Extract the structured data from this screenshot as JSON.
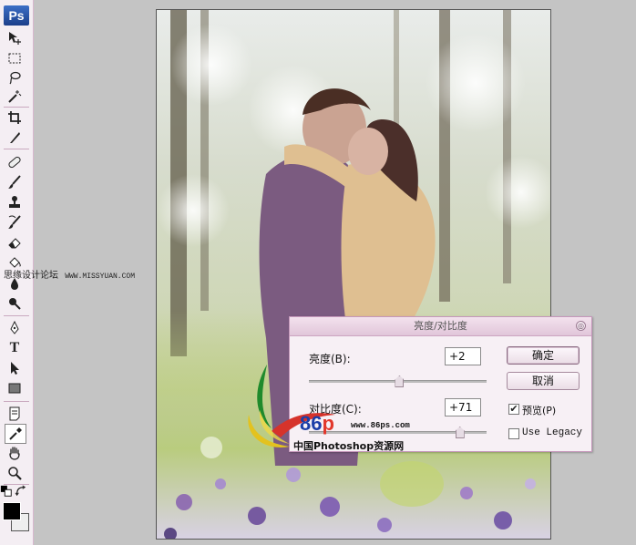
{
  "app": {
    "logo_text": "Ps"
  },
  "toolbox": {
    "tools": [
      {
        "name": "move-tool",
        "icon": "move-icon"
      },
      {
        "name": "marquee-tool",
        "icon": "marquee-icon"
      },
      {
        "name": "lasso-tool",
        "icon": "lasso-icon"
      },
      {
        "name": "magic-wand-tool",
        "icon": "magic-wand-icon"
      },
      {
        "name": "crop-tool",
        "icon": "crop-icon"
      },
      {
        "name": "slice-tool",
        "icon": "slice-icon"
      },
      {
        "name": "healing-brush-tool",
        "icon": "bandage-icon"
      },
      {
        "name": "brush-tool",
        "icon": "brush-icon"
      },
      {
        "name": "clone-stamp-tool",
        "icon": "stamp-icon"
      },
      {
        "name": "history-brush-tool",
        "icon": "history-brush-icon"
      },
      {
        "name": "eraser-tool",
        "icon": "eraser-icon"
      },
      {
        "name": "paint-bucket-tool",
        "icon": "bucket-icon"
      },
      {
        "name": "blur-tool",
        "icon": "drop-icon"
      },
      {
        "name": "dodge-tool",
        "icon": "dodge-icon"
      },
      {
        "name": "pen-tool",
        "icon": "pen-icon"
      },
      {
        "name": "type-tool",
        "icon": "type-icon",
        "glyph": "T"
      },
      {
        "name": "path-selection-tool",
        "icon": "arrow-icon"
      },
      {
        "name": "shape-tool",
        "icon": "rectangle-icon"
      },
      {
        "name": "notes-tool",
        "icon": "note-icon"
      },
      {
        "name": "eyedropper-tool",
        "icon": "eyedropper-icon"
      },
      {
        "name": "hand-tool",
        "icon": "hand-icon"
      },
      {
        "name": "zoom-tool",
        "icon": "zoom-icon"
      }
    ],
    "foreground_color": "#000000",
    "background_color": "#eeeeee"
  },
  "watermark_top": {
    "text": "思缘设计论坛",
    "url": "WWW.MISSYUAN.COM"
  },
  "dialog": {
    "title": "亮度/对比度",
    "brightness_label": "亮度(B):",
    "brightness_value": "+2",
    "brightness_slider_fraction": 0.51,
    "contrast_label": "对比度(C):",
    "contrast_value": "+71",
    "contrast_slider_fraction": 0.85,
    "ok_label": "确定",
    "cancel_label": "取消",
    "preview_label": "预览(P)",
    "preview_checked": true,
    "legacy_label": "Use Legacy",
    "legacy_checked": false
  },
  "watermark_logo": {
    "number_a": "8",
    "number_b": "6",
    "number_c": "p",
    "url": "www.86ps.com",
    "name": "中国Photoshop资源网"
  }
}
